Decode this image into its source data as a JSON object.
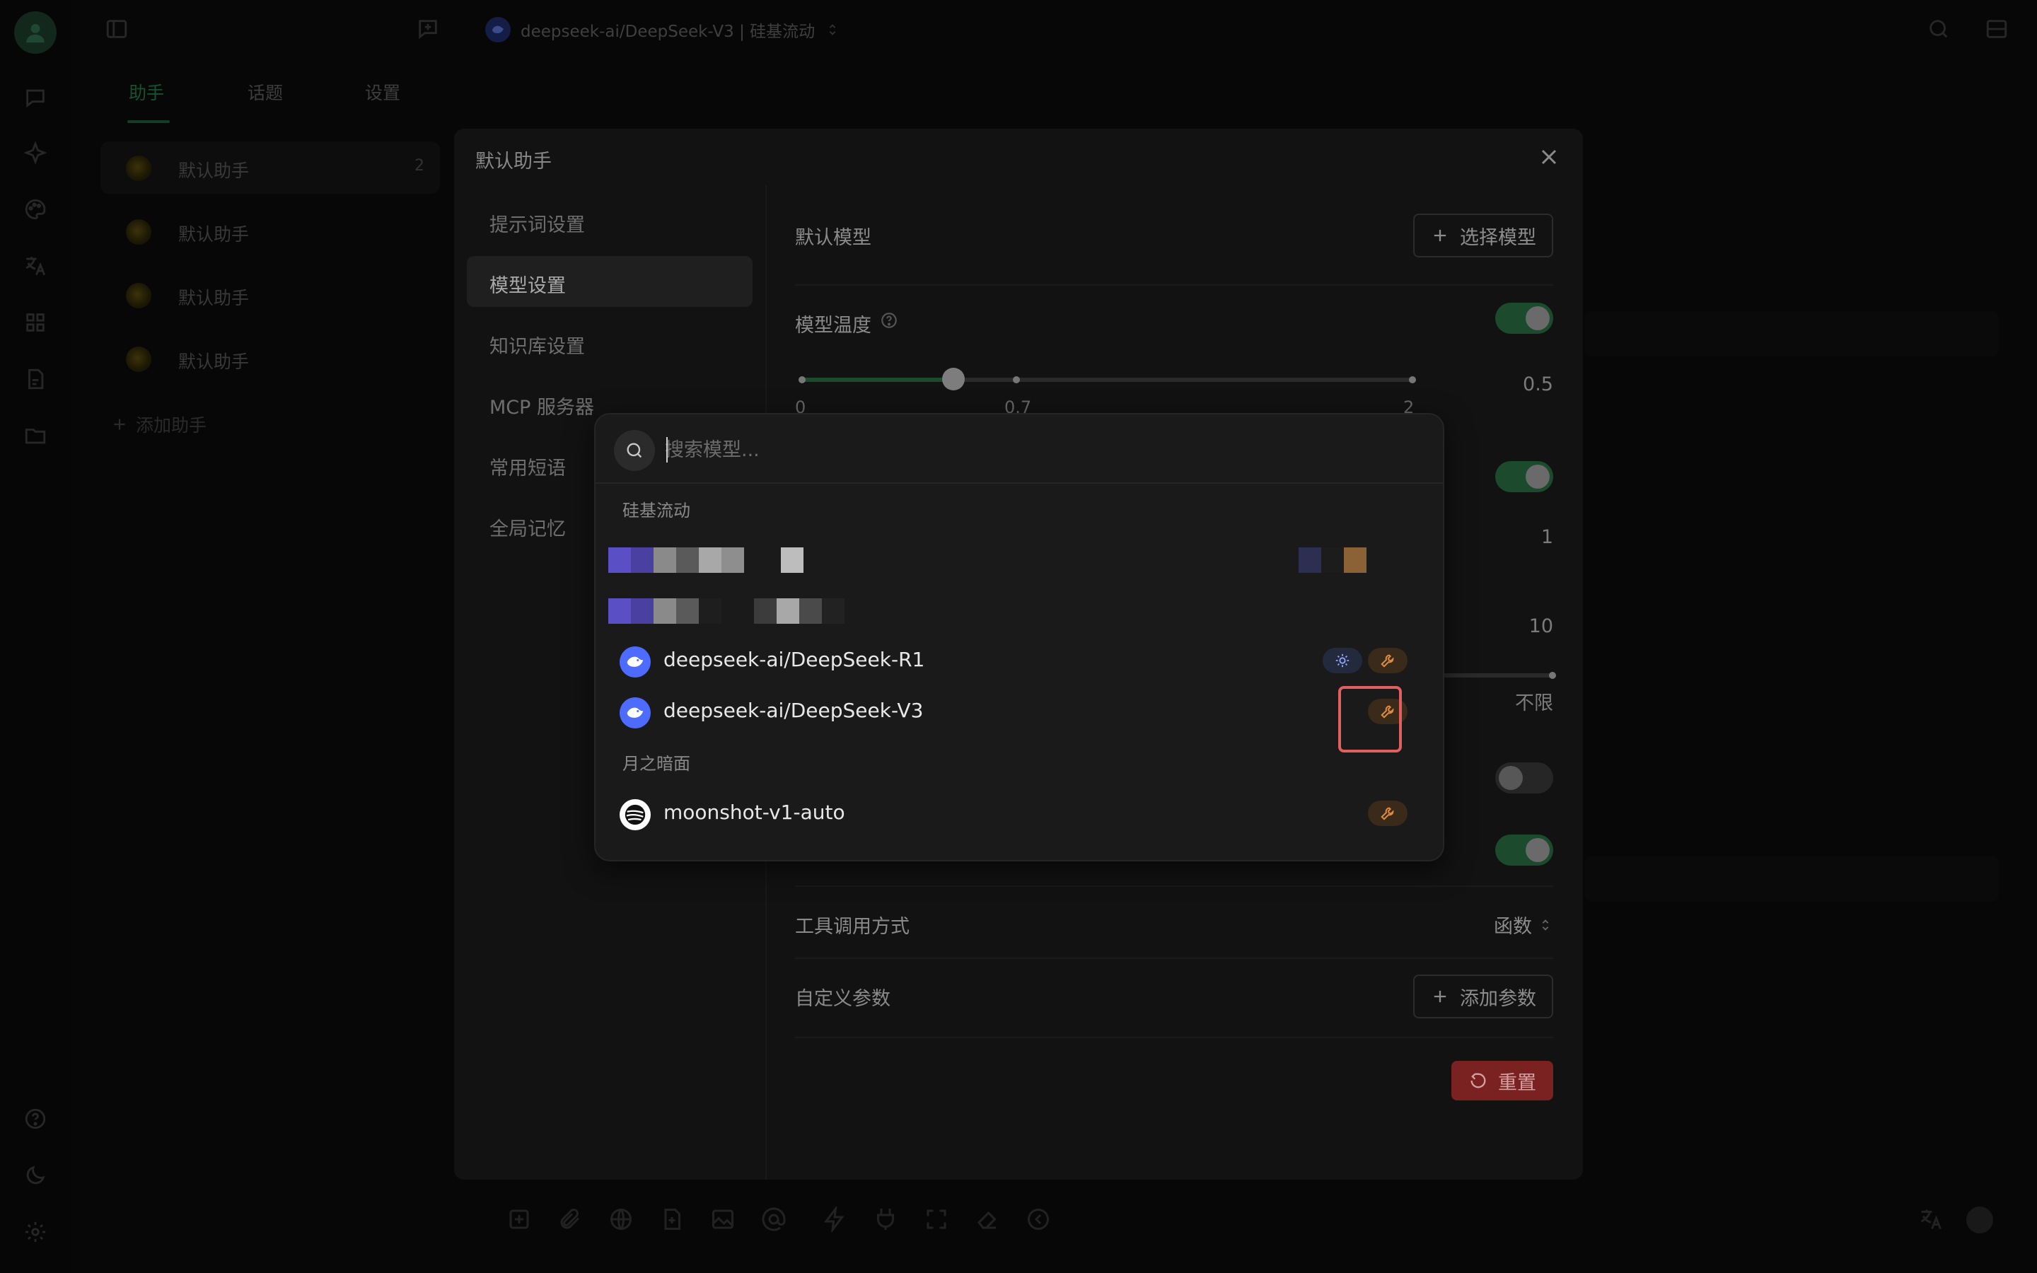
{
  "header": {
    "model_title": "deepseek-ai/DeepSeek-V3 | 硅基流动"
  },
  "sidebar": {
    "tabs": [
      {
        "label": "助手",
        "active": true
      },
      {
        "label": "话题",
        "active": false
      },
      {
        "label": "设置",
        "active": false
      }
    ],
    "assistants": [
      {
        "label": "默认助手",
        "badge": "2"
      },
      {
        "label": "默认助手"
      },
      {
        "label": "默认助手"
      },
      {
        "label": "默认助手"
      }
    ],
    "add_label": "添加助手"
  },
  "modal": {
    "title": "默认助手",
    "nav": [
      {
        "label": "提示词设置"
      },
      {
        "label": "模型设置",
        "active": true
      },
      {
        "label": "知识库设置"
      },
      {
        "label": "MCP 服务器"
      },
      {
        "label": "常用短语"
      },
      {
        "label": "全局记忆"
      }
    ],
    "default_model_label": "默认模型",
    "select_model_button": "选择模型",
    "temperature_label": "模型温度",
    "temperature_value": "0.5",
    "temperature_ticks": [
      "0",
      "0.7",
      "2"
    ],
    "context_value": "1",
    "max_tokens_value": "10",
    "unlimited_label": "不限",
    "tool_call_label": "工具调用方式",
    "tool_call_value": "函数",
    "custom_params_label": "自定义参数",
    "add_param_button": "添加参数",
    "reset_button": "重置"
  },
  "model_picker": {
    "search_placeholder": "搜索模型...",
    "groups": [
      {
        "name": "硅基流动",
        "models": [
          {
            "name": "deepseek-ai/DeepSeek-R1",
            "tags": [
              "reasoning",
              "tool"
            ]
          },
          {
            "name": "deepseek-ai/DeepSeek-V3",
            "tags": [
              "tool"
            ]
          }
        ]
      },
      {
        "name": "月之暗面",
        "models": [
          {
            "name": "moonshot-v1-auto",
            "tags": [
              "tool"
            ]
          }
        ]
      }
    ]
  },
  "colors": {
    "accent_green": "#1b4a2d",
    "tool_tag": "#e08a3c",
    "reset_red": "#c23b3b",
    "highlight": "#e0605f",
    "deepseek_blue": "#4d6bfe"
  }
}
